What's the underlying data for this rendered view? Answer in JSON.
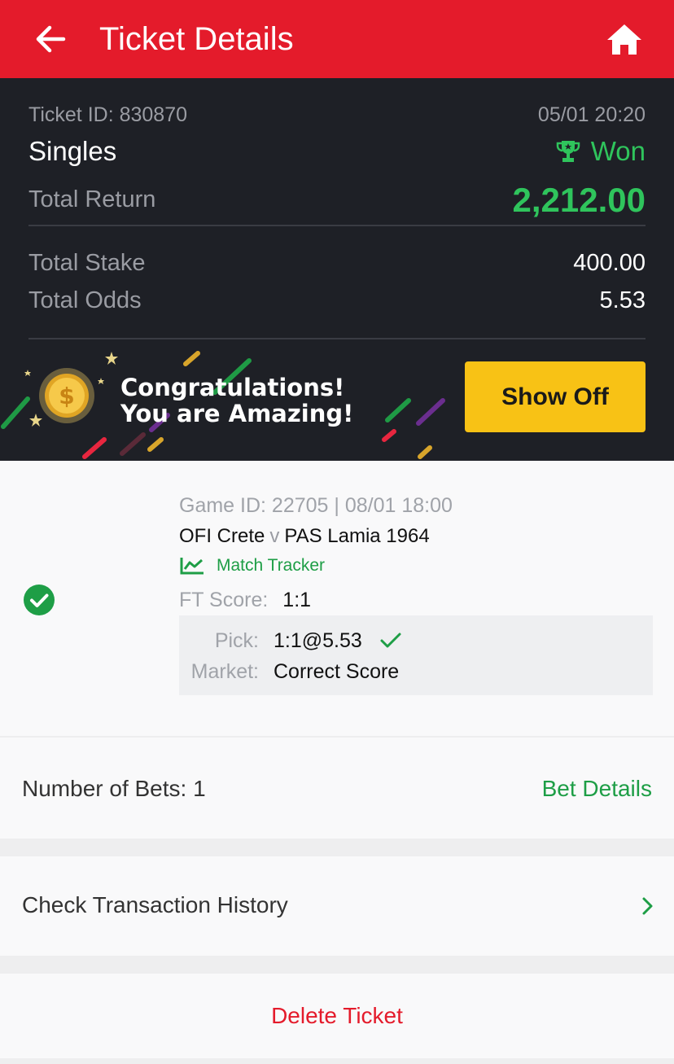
{
  "header": {
    "title": "Ticket Details"
  },
  "ticket": {
    "id_label": "Ticket ID: 830870",
    "datetime": "05/01 20:20",
    "type": "Singles",
    "status": "Won",
    "total_return_label": "Total Return",
    "total_return": "2,212.00",
    "total_stake_label": "Total Stake",
    "total_stake": "400.00",
    "total_odds_label": "Total Odds",
    "total_odds": "5.53"
  },
  "banner": {
    "line1": "Congratulations!",
    "line2": "You are Amazing!",
    "button": "Show Off"
  },
  "bet": {
    "game_meta": "Game ID: 22705 | 08/01 18:00",
    "home": "OFI Crete",
    "vs": "v",
    "away": "PAS Lamia 1964",
    "tracker_label": "Match Tracker",
    "ft_label": "FT Score:",
    "ft_value": "1:1",
    "pick_label": "Pick:",
    "pick_value": "1:1@5.53",
    "market_label": "Market:",
    "market_value": "Correct Score"
  },
  "footer": {
    "num_bets": "Number of Bets: 1",
    "bet_details": "Bet Details",
    "history": "Check Transaction History",
    "delete": "Delete Ticket"
  },
  "colors": {
    "brand_red": "#e41b2b",
    "win_green": "#2fc45c",
    "link_green": "#1e9e46",
    "show_off_yellow": "#f8c215",
    "summary_bg": "#1e2026"
  },
  "icons": {
    "back": "arrow-left-icon",
    "home": "home-icon",
    "trophy": "trophy-icon",
    "coin": "dollar-coin-icon",
    "status": "check-circle-icon",
    "tracker": "chart-line-icon",
    "pick_check": "checkmark-icon",
    "chevron": "chevron-right-icon"
  }
}
